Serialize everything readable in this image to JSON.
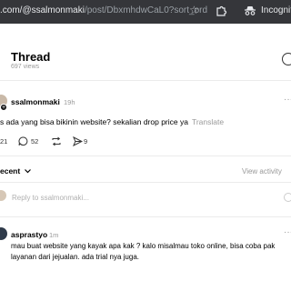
{
  "browser": {
    "url_host": ".com/@ssalmonmaki",
    "url_path": "/post/DbxmhdwCaL0?sort_order...",
    "incognito_label": "Incognito",
    "icons": [
      "star-icon",
      "extension-icon",
      "incognito-icon"
    ]
  },
  "thread": {
    "title": "Thread",
    "views": "697 views",
    "header_icon": "circle-icon"
  },
  "post": {
    "username": "ssalmonmaki",
    "time": "19h",
    "text": "s ada yang bisa bikinin website? sekalian drop price ya",
    "translate": "Translate",
    "more_icon": "more-icon",
    "badge": "+",
    "likes": "21",
    "comments": "52",
    "reposts": "",
    "shares": "9"
  },
  "recent": {
    "label": "Recent",
    "label_shown": "ecent",
    "view_activity": "View activity"
  },
  "reply": {
    "placeholder": "Reply to ssalmonmaki..."
  },
  "comment": {
    "username": "asprastyo",
    "time": "1m",
    "line1": "mau buat website yang kayak apa kak ? kalo misalmau toko online, bisa coba pak",
    "line2": "layanan dari jejualan. ada trial nya juga."
  },
  "colors": {
    "chrome_bg": "#35363a",
    "muted_text": "#999999",
    "divider": "#ebebeb"
  }
}
